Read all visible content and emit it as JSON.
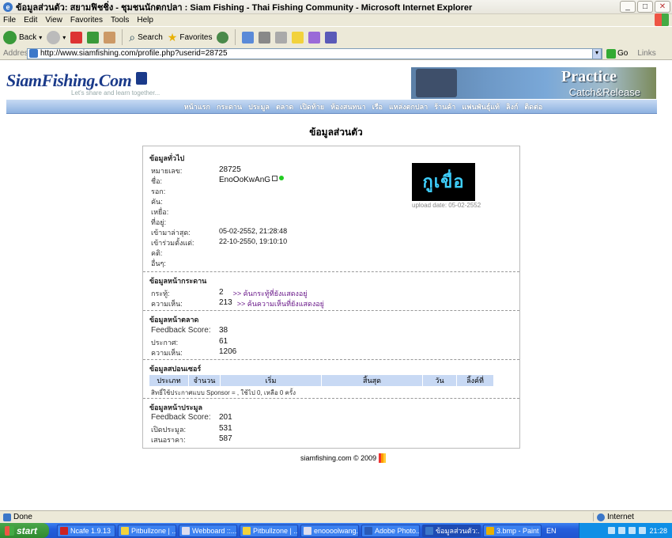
{
  "window": {
    "title": "ข้อมูลส่วนตัว: สยามฟิชชิ่ง - ชุมชนนักตกปลา : Siam Fishing - Thai Fishing Community - Microsoft Internet Explorer",
    "buttons": [
      "_",
      "□",
      "✕"
    ]
  },
  "menu": [
    "File",
    "Edit",
    "View",
    "Favorites",
    "Tools",
    "Help"
  ],
  "toolbar": {
    "back": "Back",
    "search": "Search",
    "favorites": "Favorites"
  },
  "address": {
    "label": "Address",
    "url": "http://www.siamfishing.com/profile.php?userid=28725",
    "go": "Go",
    "links": "Links"
  },
  "site": {
    "logo": "SiamFishing.Com",
    "tagline": "Let's share and learn together...",
    "banner_line1": "Practice",
    "banner_line2": "Catch&Release",
    "nav": [
      "หน้าแรก",
      "กระดาน",
      "ประมูล",
      "ตลาด",
      "เปิดท้าย",
      "ห้องสนทนา",
      "เรือ",
      "แหล่งตกปลา",
      "ร้านค้า",
      "แฟนพันธุ์แท้",
      "ลิงก์",
      "ติดต่อ"
    ]
  },
  "page_title": "ข้อมูลส่วนตัว",
  "general": {
    "heading": "ข้อมูลทั่วไป",
    "rows": [
      {
        "k": "หมายเลข:",
        "v": "28725"
      },
      {
        "k": "ชื่อ:",
        "v": "EnoOoKwAnG"
      },
      {
        "k": "รอก:",
        "v": ""
      },
      {
        "k": "คัน:",
        "v": ""
      },
      {
        "k": "เหยื่อ:",
        "v": ""
      },
      {
        "k": "ที่อยู่:",
        "v": ""
      },
      {
        "k": "เข้ามาล่าสุด:",
        "v": "05-02-2552, 21:28:48"
      },
      {
        "k": "เข้าร่วมตั้งแต่:",
        "v": "22-10-2550, 19:10:10"
      },
      {
        "k": "คติ:",
        "v": ""
      },
      {
        "k": "อื่นๆ:",
        "v": ""
      }
    ],
    "avatar_text": "กูเขื่อ",
    "upload_date": "upload date: 05-02-2552"
  },
  "board": {
    "heading": "ข้อมูลหน้ากระดาน",
    "rows": [
      {
        "k": "กระทู้:",
        "v": "2",
        "link": ">> ค้นกระทู้ที่ยังแสดงอยู่"
      },
      {
        "k": "ความเห็น:",
        "v": "213",
        "link": ">> ค้นความเห็นที่ยังแสดงอยู่"
      }
    ]
  },
  "market": {
    "heading": "ข้อมูลหน้าตลาด",
    "rows": [
      {
        "k": "Feedback Score:",
        "v": "38"
      },
      {
        "k": "ประกาศ:",
        "v": "61"
      },
      {
        "k": "ความเห็น:",
        "v": "1206"
      }
    ]
  },
  "sponsor": {
    "heading": "ข้อมูลสปอนเซอร์",
    "columns": [
      "ประเภท",
      "จำนวน",
      "เริ่ม",
      "สิ้นสุด",
      "วัน",
      "ลิ้งค์ที่"
    ],
    "note": "สิทธิ์ใช้ประกาศแบบ Sponsor = , ใช้ไป 0, เหลือ 0 ครั้ง"
  },
  "auction": {
    "heading": "ข้อมูลหน้าประมูล",
    "rows": [
      {
        "k": "Feedback Score:",
        "v": "201"
      },
      {
        "k": "เปิดประมูล:",
        "v": "531"
      },
      {
        "k": "เสนอราคา:",
        "v": "587"
      }
    ]
  },
  "footer": "siamfishing.com © 2009",
  "status": {
    "text": "Done",
    "zone": "Internet"
  },
  "taskbar": {
    "start": "start",
    "tasks": [
      "Ncafe 1.9.13",
      "Pitbullzone | ...",
      "Webboard ::...",
      "Pitbullzone | ...",
      "enoooolwang...",
      "Adobe Photo...",
      "ข้อมูลส่วนตัว:...",
      "3.bmp - Paint"
    ],
    "lang": "EN",
    "clock": "21:28"
  }
}
